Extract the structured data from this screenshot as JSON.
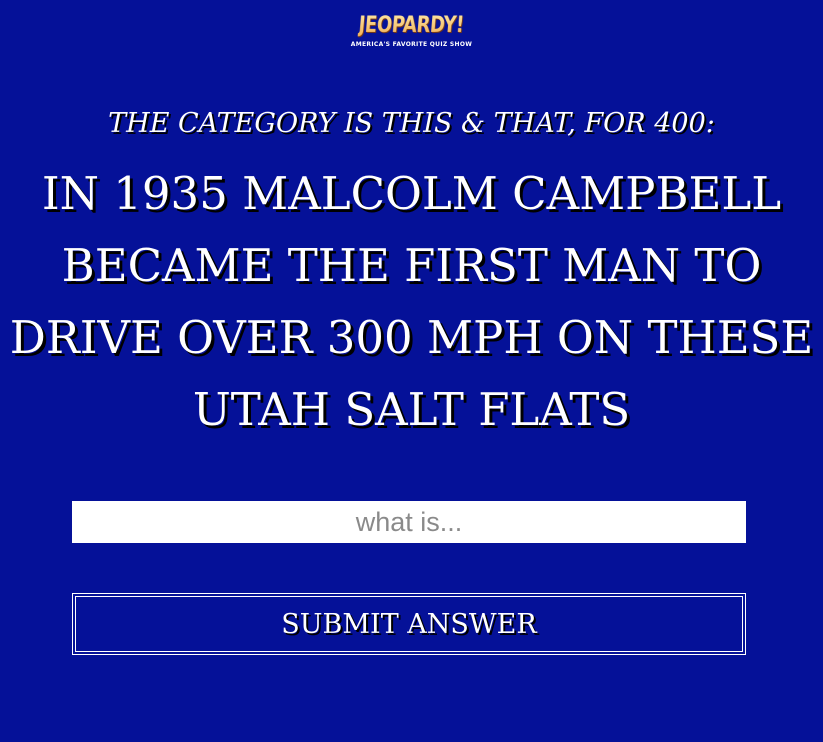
{
  "logo": {
    "wordmark": "JEOPARDY!",
    "tagline": "AMERICA'S FAVORITE QUIZ SHOW"
  },
  "category_line": "THE CATEGORY IS THIS & THAT, FOR 400:",
  "clue": "IN 1935 MALCOLM CAMPBELL BECAME THE FIRST MAN TO DRIVE OVER 300 MPH ON THESE UTAH SALT FLATS",
  "answer": {
    "placeholder": "what is...",
    "value": ""
  },
  "submit": {
    "label": "SUBMIT ANSWER"
  },
  "colors": {
    "background": "#051198",
    "text": "#ffffff",
    "logo_gold": "#f6c36b"
  }
}
